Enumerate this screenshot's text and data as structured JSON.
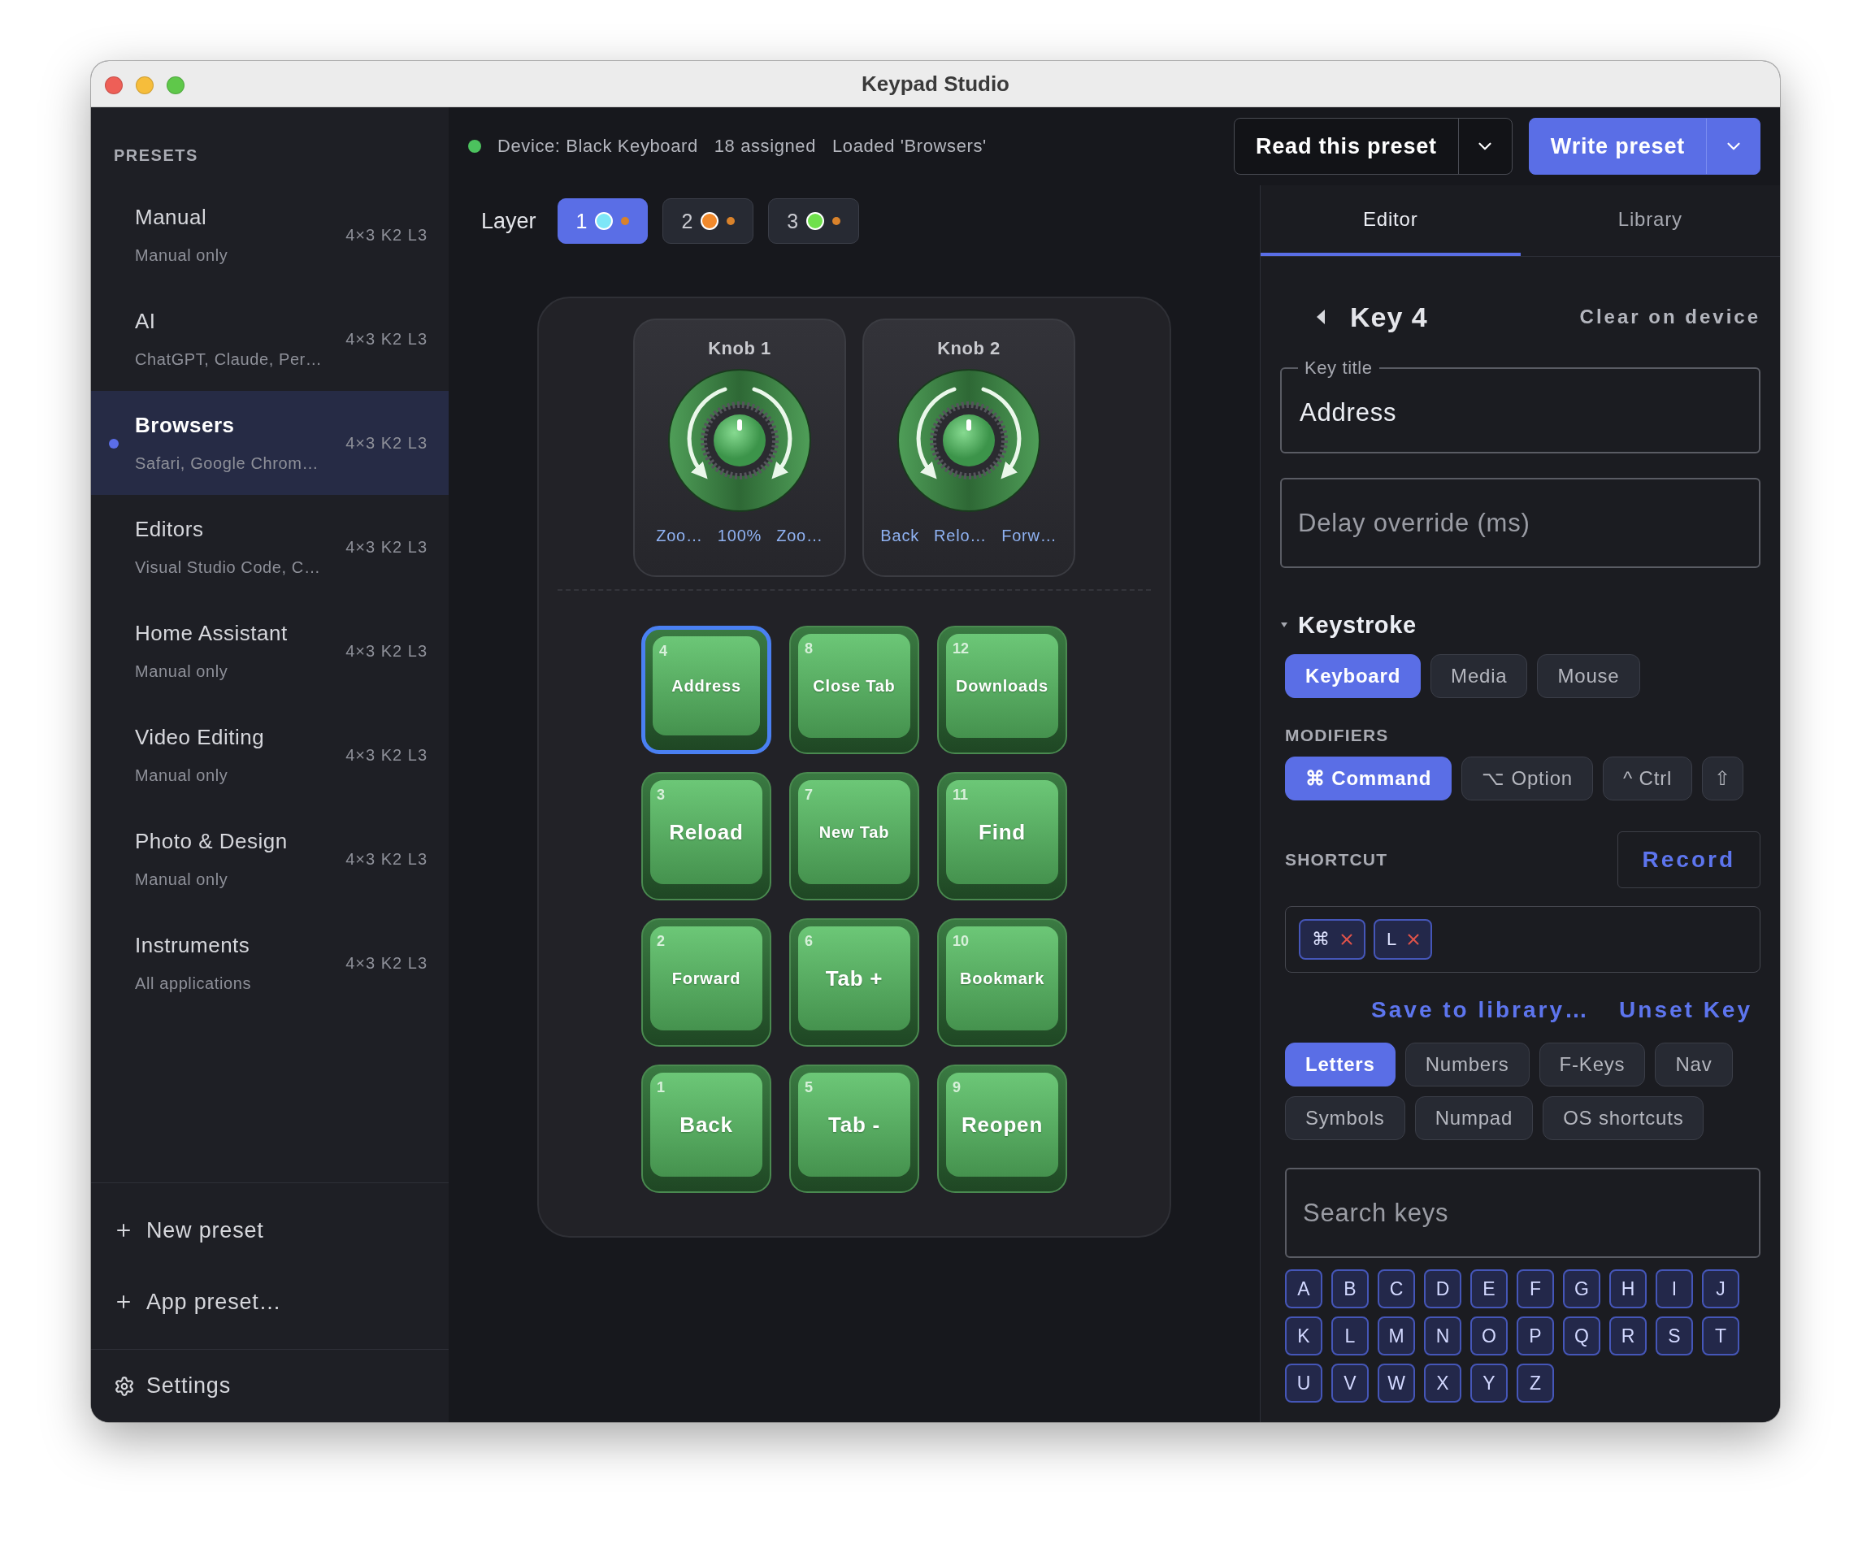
{
  "window": {
    "title": "Keypad Studio"
  },
  "sidebar": {
    "heading": "PRESETS",
    "presets": [
      {
        "name": "Manual",
        "subtitle": "Manual only",
        "layout": "4×3 K2 L3",
        "selected": false
      },
      {
        "name": "AI",
        "subtitle": "ChatGPT, Claude, Per…",
        "layout": "4×3 K2 L3",
        "selected": false
      },
      {
        "name": "Browsers",
        "subtitle": "Safari, Google Chrom…",
        "layout": "4×3 K2 L3",
        "selected": true
      },
      {
        "name": "Editors",
        "subtitle": "Visual Studio Code, C…",
        "layout": "4×3 K2 L3",
        "selected": false
      },
      {
        "name": "Home Assistant",
        "subtitle": "Manual only",
        "layout": "4×3 K2 L3",
        "selected": false
      },
      {
        "name": "Video Editing",
        "subtitle": "Manual only",
        "layout": "4×3 K2 L3",
        "selected": false
      },
      {
        "name": "Photo & Design",
        "subtitle": "Manual only",
        "layout": "4×3 K2 L3",
        "selected": false
      },
      {
        "name": "Instruments",
        "subtitle": "All applications",
        "layout": "4×3 K2 L3",
        "selected": false
      }
    ],
    "actions": [
      "New preset",
      "App preset…"
    ],
    "settings": "Settings"
  },
  "status": {
    "connected": true,
    "device": "Device: Black Keyboard",
    "assigned": "18 assigned",
    "loaded": "Loaded 'Browsers'"
  },
  "toolbar": {
    "read_button": "Read this preset",
    "write_button": "Write preset"
  },
  "layers": {
    "label": "Layer",
    "items": [
      {
        "label": "1",
        "color": "#7de6f7",
        "selected": true
      },
      {
        "label": "2",
        "color": "#f0892c",
        "selected": false
      },
      {
        "label": "3",
        "color": "#6fe04c",
        "selected": false
      }
    ]
  },
  "knobs": [
    {
      "title": "Knob 1",
      "actions": [
        "Zoo…",
        "100%",
        "Zoo…"
      ]
    },
    {
      "title": "Knob 2",
      "actions": [
        "Back",
        "Relo…",
        "Forw…"
      ]
    }
  ],
  "keys": [
    {
      "number": "4",
      "title": "Address",
      "selected": true
    },
    {
      "number": "8",
      "title": "Close Tab",
      "selected": false
    },
    {
      "number": "12",
      "title": "Downloads",
      "selected": false
    },
    {
      "number": "3",
      "title": "Reload",
      "selected": false
    },
    {
      "number": "7",
      "title": "New Tab",
      "selected": false
    },
    {
      "number": "11",
      "title": "Find",
      "selected": false
    },
    {
      "number": "2",
      "title": "Forward",
      "selected": false
    },
    {
      "number": "6",
      "title": "Tab +",
      "selected": false
    },
    {
      "number": "10",
      "title": "Bookmark",
      "selected": false
    },
    {
      "number": "1",
      "title": "Back",
      "selected": false
    },
    {
      "number": "5",
      "title": "Tab -",
      "selected": false
    },
    {
      "number": "9",
      "title": "Reopen",
      "selected": false
    }
  ],
  "editor": {
    "tabs": [
      {
        "label": "Editor",
        "selected": true
      },
      {
        "label": "Library",
        "selected": false
      }
    ],
    "heading": "Key 4",
    "clear_link": "Clear on device",
    "key_title": {
      "label": "Key title",
      "value": "Address"
    },
    "delay": {
      "placeholder": "Delay override (ms)"
    },
    "section": {
      "title": "Keystroke",
      "expanded": true
    },
    "types": [
      {
        "label": "Keyboard",
        "selected": true
      },
      {
        "label": "Media",
        "selected": false
      },
      {
        "label": "Mouse",
        "selected": false
      }
    ],
    "modifiers_label": "MODIFIERS",
    "modifiers": [
      {
        "label": "⌘ Command",
        "selected": true
      },
      {
        "label": "⌥ Option",
        "selected": false
      },
      {
        "label": "^ Ctrl",
        "selected": false
      },
      {
        "label": "⇧",
        "selected": false
      }
    ],
    "shortcut_label": "SHORTCUT",
    "record_button": "Record",
    "shortcut_keys": [
      "⌘",
      "L"
    ],
    "links": [
      "Save to library…",
      "Unset Key"
    ],
    "categories": [
      {
        "label": "Letters",
        "selected": true
      },
      {
        "label": "Numbers",
        "selected": false
      },
      {
        "label": "F-Keys",
        "selected": false
      },
      {
        "label": "Nav",
        "selected": false
      },
      {
        "label": "Symbols",
        "selected": false
      },
      {
        "label": "Numpad",
        "selected": false
      },
      {
        "label": "OS shortcuts",
        "selected": false
      }
    ],
    "search": {
      "placeholder": "Search keys"
    },
    "letters": [
      "A",
      "B",
      "C",
      "D",
      "E",
      "F",
      "G",
      "H",
      "I",
      "J",
      "K",
      "L",
      "M",
      "N",
      "O",
      "P",
      "Q",
      "R",
      "S",
      "T",
      "U",
      "V",
      "W",
      "X",
      "Y",
      "Z"
    ]
  }
}
